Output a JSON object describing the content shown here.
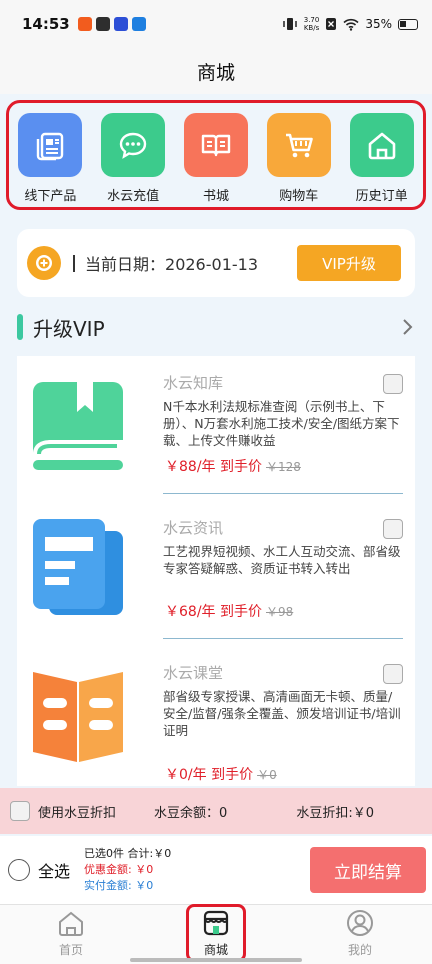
{
  "status_bar": {
    "time": "14:53",
    "net_speed_value": "3.70",
    "net_speed_unit": "KB/s",
    "battery": "35%",
    "app_icon_colors": [
      "#f25c1e",
      "#2e2e2e",
      "#2d4fd6",
      "#1e7fe0"
    ]
  },
  "header": {
    "title": "商城"
  },
  "quick_nav": [
    {
      "label": "线下产品",
      "icon": "catalog-icon",
      "color": "#5a8ff0"
    },
    {
      "label": "水云充值",
      "icon": "chat-bubble-icon",
      "color": "#3ccb8c"
    },
    {
      "label": "书城",
      "icon": "open-book-icon",
      "color": "#f7745a"
    },
    {
      "label": "购物车",
      "icon": "cart-icon",
      "color": "#f8a83a"
    },
    {
      "label": "历史订单",
      "icon": "house-icon",
      "color": "#3ccb8c"
    }
  ],
  "date_card": {
    "label": "当前日期：",
    "date": "2026-01-13",
    "vip_button": "VIP升级"
  },
  "section": {
    "title": "升级VIP",
    "accent_color": "#3cc8a0"
  },
  "products": [
    {
      "name": "水云知库",
      "desc": "N千本水利法规标准查阅（示例书上、下册）、N万套水利施工技术/安全/图纸方案下载、上传文件赚收益",
      "price": "￥88/年",
      "hand_price": "到手价",
      "old_price": "￥128",
      "icon": "book-bookmark-icon",
      "color": "#4fd39a"
    },
    {
      "name": "水云资讯",
      "desc": "工艺视界短视频、水工人互动交流、部省级专家答疑解惑、资质证书转入转出",
      "price": "￥68/年",
      "hand_price": "到手价",
      "old_price": "￥98",
      "icon": "news-icon",
      "color": "#2f8fe0"
    },
    {
      "name": "水云课堂",
      "desc": "部省级专家授课、高清画面无卡顿、质量/安全/监督/强条全覆盖、颁发培训证书/培训证明",
      "price": "￥0/年",
      "hand_price": "到手价",
      "old_price": "￥0",
      "icon": "course-book-icon",
      "color": "#f5823a"
    }
  ],
  "bean_bar": {
    "use_label": "使用水豆折扣",
    "balance_label": "水豆余额：0",
    "discount_label": "水豆折扣:￥0"
  },
  "checkout": {
    "select_all": "全选",
    "selected": "已选0件 合计:￥0",
    "discount": "优惠金额: ￥0",
    "actual": "实付金额: ￥0",
    "pay_button": "立即结算"
  },
  "tabs": [
    {
      "label": "首页",
      "icon": "home-icon"
    },
    {
      "label": "商城",
      "icon": "store-icon"
    },
    {
      "label": "我的",
      "icon": "profile-icon"
    }
  ]
}
